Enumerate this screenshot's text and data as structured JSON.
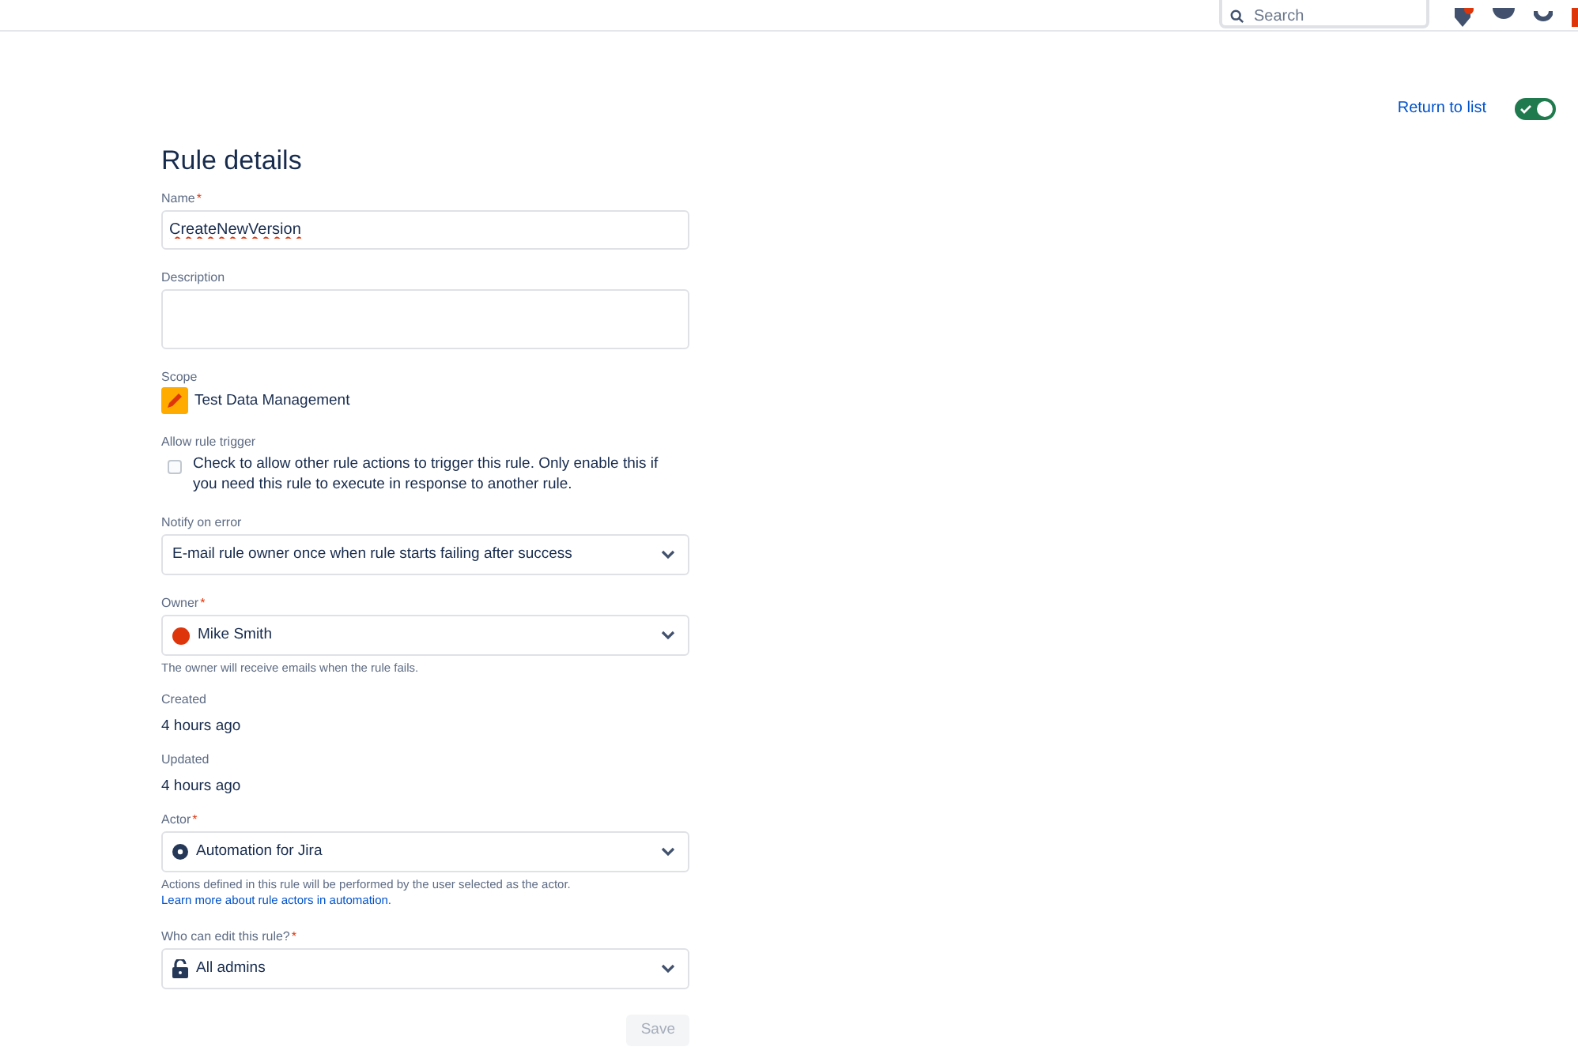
{
  "top_bar": {
    "search": {
      "placeholder": "Search"
    }
  },
  "return_link": "Return to list",
  "rule_enabled": {
    "on": true
  },
  "title": "Rule details",
  "fields": [
    {
      "kind": "text",
      "label": "Name",
      "required_mark": "*",
      "value": "CreateNewVersion"
    },
    {
      "kind": "textarea",
      "label": "Description"
    },
    {
      "kind": "scope",
      "label": "Scope",
      "value": "Test Data Management"
    },
    {
      "kind": "checkbox",
      "label": "Allow rule trigger",
      "checked": false,
      "text": "Check to allow other rule actions to trigger this rule. Only enable this if you need this rule to execute in response to another rule."
    },
    {
      "kind": "select",
      "label": "Notify on error",
      "value": "E-mail rule owner once when rule starts failing after success"
    },
    {
      "kind": "user-select",
      "label": "Owner",
      "required_mark": "*",
      "value": "Mike Smith",
      "help": "The owner will receive emails when the rule fails."
    },
    {
      "kind": "static",
      "label": "Created",
      "value": "4 hours ago"
    },
    {
      "kind": "static",
      "label": "Updated",
      "value": "4 hours ago"
    },
    {
      "kind": "app-select",
      "label": "Actor",
      "required_mark": "*",
      "value": "Automation for Jira",
      "help": "Actions defined in this rule will be performed by the user selected as the actor.",
      "help_link": "Learn more about rule actors in automation."
    },
    {
      "kind": "lock-select",
      "label": "Who can edit this rule?",
      "required_mark": "*",
      "value": "All admins"
    }
  ],
  "save_button": {
    "label": "Save",
    "disabled": true
  }
}
